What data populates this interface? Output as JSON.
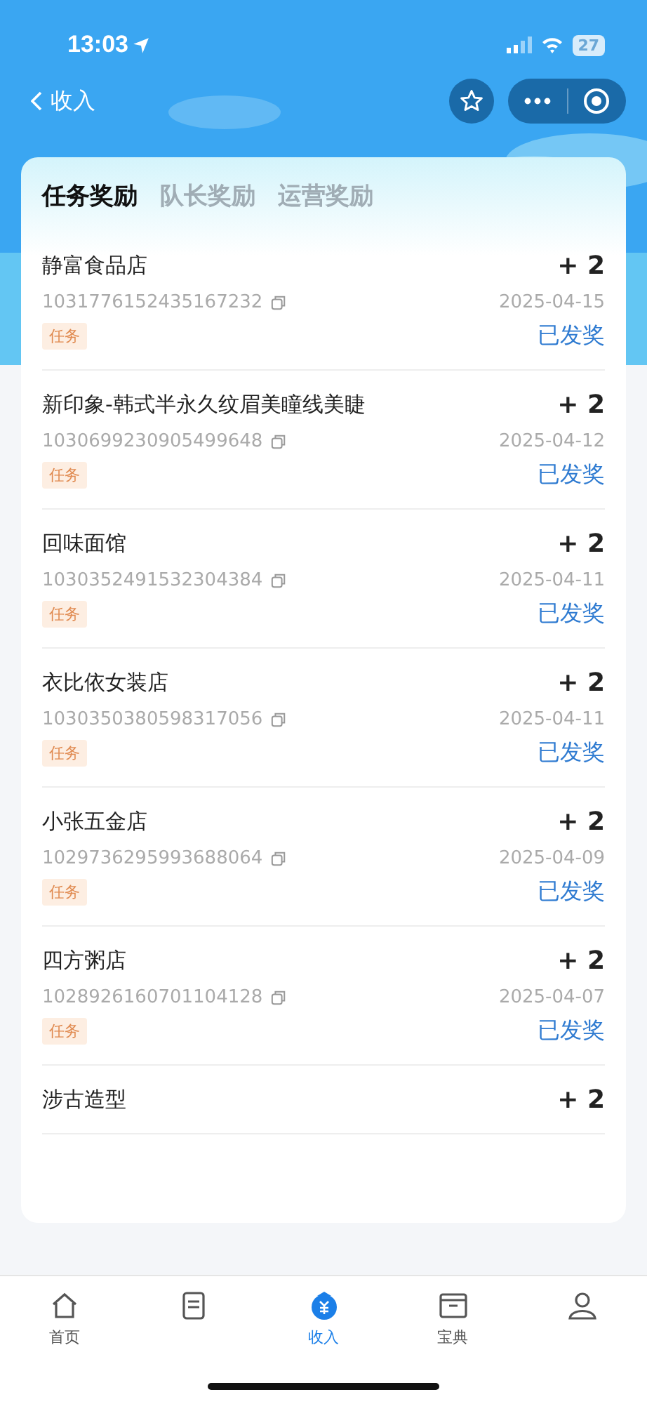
{
  "status_bar": {
    "time": "13:03",
    "battery": "27"
  },
  "nav": {
    "back_label": "收入"
  },
  "tabs": [
    {
      "label": "任务奖励",
      "selected": true
    },
    {
      "label": "队长奖励",
      "selected": false
    },
    {
      "label": "运营奖励",
      "selected": false
    }
  ],
  "records": [
    {
      "name": "静富食品店",
      "points": "+ 2",
      "order_id": "1031776152435167232",
      "date": "2025-04-15",
      "tag": "任务",
      "status": "已发奖"
    },
    {
      "name": "新印象-韩式半永久纹眉美瞳线美睫",
      "points": "+ 2",
      "order_id": "1030699230905499648",
      "date": "2025-04-12",
      "tag": "任务",
      "status": "已发奖"
    },
    {
      "name": "回味面馆",
      "points": "+ 2",
      "order_id": "1030352491532304384",
      "date": "2025-04-11",
      "tag": "任务",
      "status": "已发奖"
    },
    {
      "name": "衣比依女装店",
      "points": "+ 2",
      "order_id": "1030350380598317056",
      "date": "2025-04-11",
      "tag": "任务",
      "status": "已发奖"
    },
    {
      "name": "小张五金店",
      "points": "+ 2",
      "order_id": "1029736295993688064",
      "date": "2025-04-09",
      "tag": "任务",
      "status": "已发奖"
    },
    {
      "name": "四方粥店",
      "points": "+ 2",
      "order_id": "1028926160701104128",
      "date": "2025-04-07",
      "tag": "任务",
      "status": "已发奖"
    },
    {
      "name": "涉古造型",
      "points": "+ 2"
    }
  ],
  "tab_bar": [
    {
      "kind": "home",
      "label": "首页",
      "selected": false
    },
    {
      "kind": "doc",
      "selected": false
    },
    {
      "kind": "income",
      "label": "收入",
      "selected": true
    },
    {
      "kind": "book",
      "label": "宝典",
      "selected": false
    },
    {
      "kind": "person",
      "selected": false
    }
  ]
}
